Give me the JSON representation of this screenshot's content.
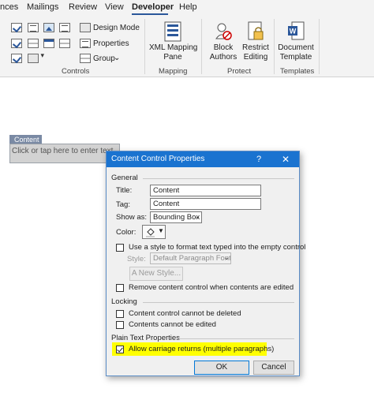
{
  "ribbon": {
    "tabs": [
      "nces",
      "Mailings",
      "Review",
      "View",
      "Developer",
      "Help"
    ],
    "active_tab": "Developer",
    "controls": {
      "design_mode": "Design Mode",
      "properties": "Properties",
      "group": "Group",
      "label": "Controls"
    },
    "mapping": {
      "xml_line1": "XML Mapping",
      "xml_line2": "Pane",
      "label": "Mapping"
    },
    "protect": {
      "block_line1": "Block",
      "block_line2": "Authors",
      "restrict_line1": "Restrict",
      "restrict_line2": "Editing",
      "label": "Protect"
    },
    "templates": {
      "doc_line1": "Document",
      "doc_line2": "Template",
      "label": "Templates"
    }
  },
  "document": {
    "content_control_tag": "Content",
    "content_control_placeholder": "Click or tap here to enter text."
  },
  "dialog": {
    "title": "Content Control Properties",
    "help": "?",
    "close": "✕",
    "general": {
      "section": "General",
      "title_label": "Title:",
      "title_value": "Content",
      "tag_label": "Tag:",
      "tag_value": "Content",
      "show_as_label": "Show as:",
      "show_as_value": "Bounding Box",
      "color_label": "Color:",
      "use_style_label": "Use a style to format text typed into the empty control",
      "use_style_checked": false,
      "style_label": "Style:",
      "style_value": "Default Paragraph Font",
      "new_style_button": "New Style...",
      "remove_label": "Remove content control when contents are edited",
      "remove_checked": false
    },
    "locking": {
      "section": "Locking",
      "cannot_delete_label": "Content control cannot be deleted",
      "cannot_delete_checked": false,
      "cannot_edit_label": "Contents cannot be edited",
      "cannot_edit_checked": false
    },
    "plain_text": {
      "section": "Plain Text Properties",
      "allow_returns_label": "Allow carriage returns (multiple paragraphs)",
      "allow_returns_checked": true
    },
    "ok_button": "OK",
    "cancel_button": "Cancel"
  },
  "colors": {
    "accent": "#2b579a",
    "titlebar": "#1a73d0",
    "highlight": "#ffff00"
  }
}
